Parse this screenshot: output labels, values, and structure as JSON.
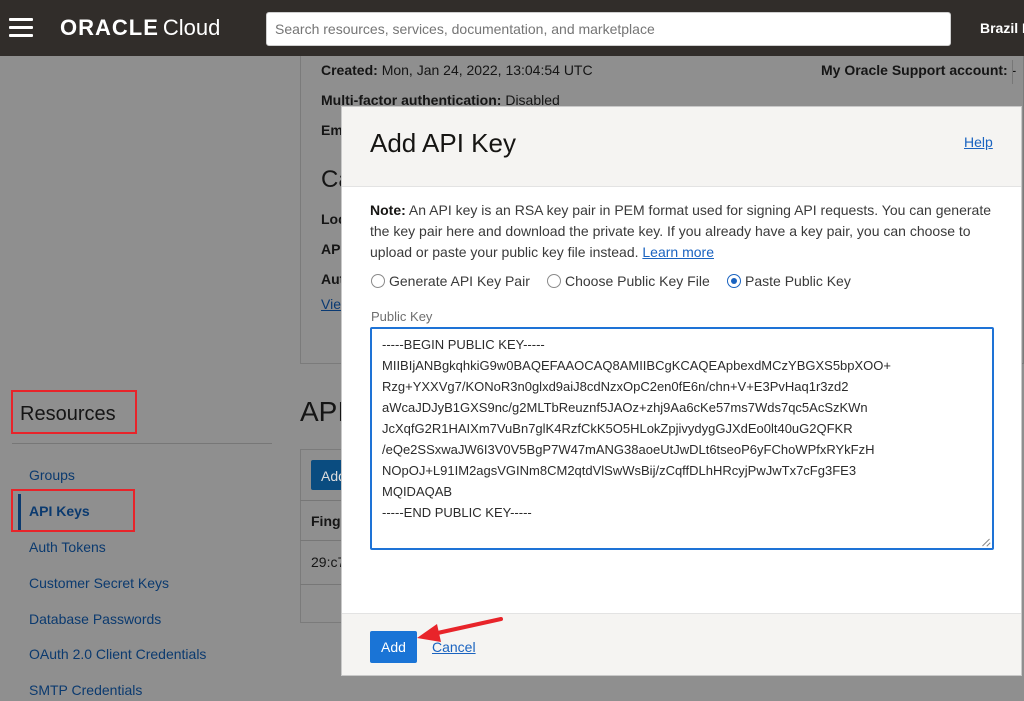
{
  "topbar": {
    "brand": "ORACLE",
    "brand_suffix": "Cloud",
    "search_placeholder": "Search resources, services, documentation, and marketplace",
    "region": "Brazil E"
  },
  "background": {
    "created_label": "Created:",
    "created_value": "Mon, Jan 24, 2022, 13:04:54 UTC",
    "support_label": "My Oracle Support account:",
    "support_value": "-",
    "mfa_label": "Multi-factor authentication:",
    "mfa_value": "Disabled",
    "email_partial": "Em",
    "capabilities_partial": "Ca",
    "local_partial": "Loc",
    "api_partial": "AP",
    "auth_partial": "Aut",
    "view_partial": "Vie",
    "api_keys_heading_partial": "API",
    "add_button_partial": "Add",
    "fingerprint_partial": "Fing",
    "fingerprint_value_partial": "29:c7"
  },
  "resources": {
    "title": "Resources",
    "items": [
      {
        "label": "Groups"
      },
      {
        "label": "API Keys",
        "active": true
      },
      {
        "label": "Auth Tokens"
      },
      {
        "label": "Customer Secret Keys"
      },
      {
        "label": "Database Passwords"
      },
      {
        "label": "OAuth 2.0 Client Credentials"
      },
      {
        "label": "SMTP Credentials"
      }
    ]
  },
  "modal": {
    "title": "Add API Key",
    "help": "Help",
    "note_label": "Note:",
    "note_text": " An API key is an RSA key pair in PEM format used for signing API requests. You can generate the key pair here and download the private key. If you already have a key pair, you can choose to upload or paste your public key file instead. ",
    "learn_more": "Learn more",
    "options": [
      {
        "label": "Generate API Key Pair",
        "checked": false
      },
      {
        "label": "Choose Public Key File",
        "checked": false
      },
      {
        "label": "Paste Public Key",
        "checked": true
      }
    ],
    "public_key_label": "Public Key",
    "public_key_value": "-----BEGIN PUBLIC KEY-----\nMIIBIjANBgkqhkiG9w0BAQEFAAOCAQ8AMIIBCgKCAQEApbexdMCzYBGXS5bpXOO+\nRzg+YXXVg7/KONoR3n0glxd9aiJ8cdNzxOpC2en0fE6n/chn+V+E3PvHaq1r3zd2\naWcaJDJyB1GXS9nc/g2MLTbReuznf5JAOz+zhj9Aa6cKe57ms7Wds7qc5AcSzKWn\nJcXqfG2R1HAIXm7VuBn7glK4RzfCkK5O5HLokZpjivydygGJXdEo0lt40uG2QFKR\n/eQe2SSxwaJW6I3V0V5BgP7W47mANG38aoeUtJwDLt6tseoP6yFChoWPfxRYkFzH\nNOpOJ+L91IM2agsVGINm8CM2qtdVlSwWsBij/zCqffDLhHRcyjPwJwTx7cFg3FE3\nMQIDAQAB\n-----END PUBLIC KEY-----",
    "add_button": "Add",
    "cancel": "Cancel"
  }
}
